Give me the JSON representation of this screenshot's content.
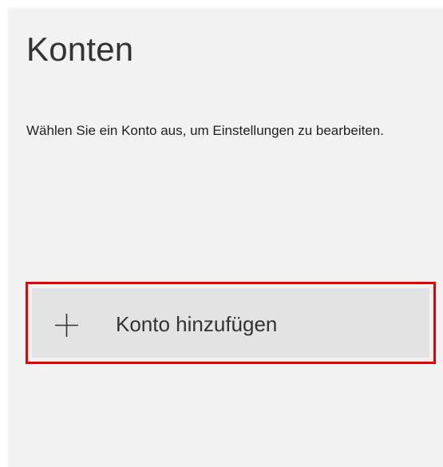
{
  "page": {
    "title": "Konten",
    "description": "Wählen Sie ein Konto aus, um Einstellungen zu bearbeiten."
  },
  "add_account": {
    "label": "Konto hinzufügen",
    "icon": "plus-icon",
    "highlight_color": "#e60000"
  }
}
